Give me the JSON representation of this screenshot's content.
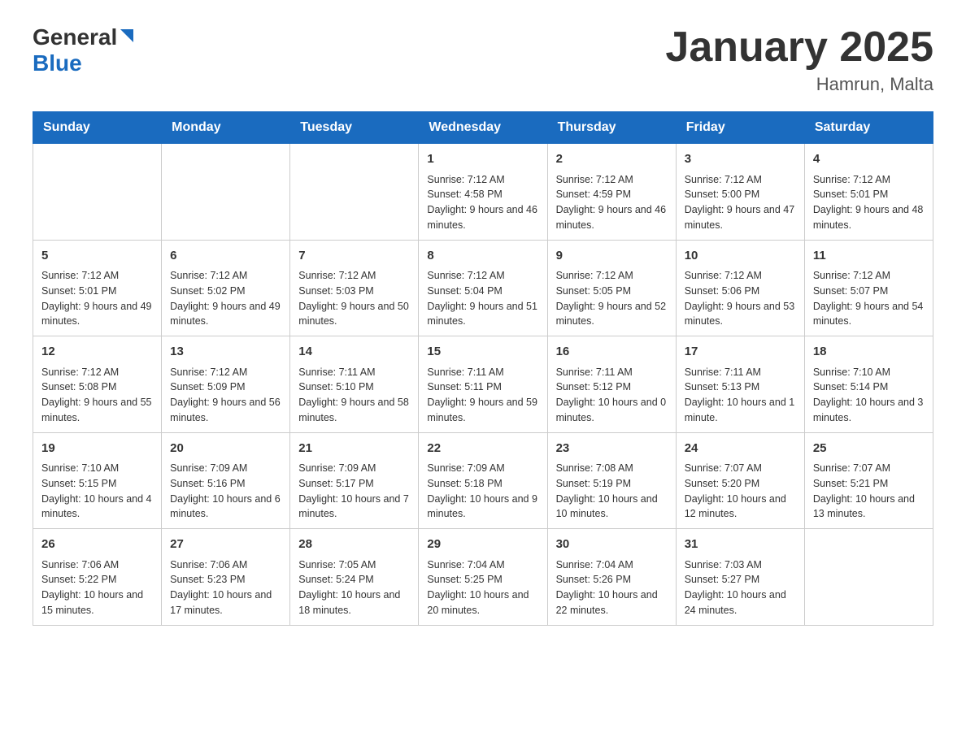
{
  "header": {
    "logo": {
      "general": "General",
      "blue": "Blue"
    },
    "title": "January 2025",
    "location": "Hamrun, Malta"
  },
  "weekdays": [
    "Sunday",
    "Monday",
    "Tuesday",
    "Wednesday",
    "Thursday",
    "Friday",
    "Saturday"
  ],
  "weeks": [
    [
      {
        "day": "",
        "info": ""
      },
      {
        "day": "",
        "info": ""
      },
      {
        "day": "",
        "info": ""
      },
      {
        "day": "1",
        "info": "Sunrise: 7:12 AM\nSunset: 4:58 PM\nDaylight: 9 hours\nand 46 minutes."
      },
      {
        "day": "2",
        "info": "Sunrise: 7:12 AM\nSunset: 4:59 PM\nDaylight: 9 hours\nand 46 minutes."
      },
      {
        "day": "3",
        "info": "Sunrise: 7:12 AM\nSunset: 5:00 PM\nDaylight: 9 hours\nand 47 minutes."
      },
      {
        "day": "4",
        "info": "Sunrise: 7:12 AM\nSunset: 5:01 PM\nDaylight: 9 hours\nand 48 minutes."
      }
    ],
    [
      {
        "day": "5",
        "info": "Sunrise: 7:12 AM\nSunset: 5:01 PM\nDaylight: 9 hours\nand 49 minutes."
      },
      {
        "day": "6",
        "info": "Sunrise: 7:12 AM\nSunset: 5:02 PM\nDaylight: 9 hours\nand 49 minutes."
      },
      {
        "day": "7",
        "info": "Sunrise: 7:12 AM\nSunset: 5:03 PM\nDaylight: 9 hours\nand 50 minutes."
      },
      {
        "day": "8",
        "info": "Sunrise: 7:12 AM\nSunset: 5:04 PM\nDaylight: 9 hours\nand 51 minutes."
      },
      {
        "day": "9",
        "info": "Sunrise: 7:12 AM\nSunset: 5:05 PM\nDaylight: 9 hours\nand 52 minutes."
      },
      {
        "day": "10",
        "info": "Sunrise: 7:12 AM\nSunset: 5:06 PM\nDaylight: 9 hours\nand 53 minutes."
      },
      {
        "day": "11",
        "info": "Sunrise: 7:12 AM\nSunset: 5:07 PM\nDaylight: 9 hours\nand 54 minutes."
      }
    ],
    [
      {
        "day": "12",
        "info": "Sunrise: 7:12 AM\nSunset: 5:08 PM\nDaylight: 9 hours\nand 55 minutes."
      },
      {
        "day": "13",
        "info": "Sunrise: 7:12 AM\nSunset: 5:09 PM\nDaylight: 9 hours\nand 56 minutes."
      },
      {
        "day": "14",
        "info": "Sunrise: 7:11 AM\nSunset: 5:10 PM\nDaylight: 9 hours\nand 58 minutes."
      },
      {
        "day": "15",
        "info": "Sunrise: 7:11 AM\nSunset: 5:11 PM\nDaylight: 9 hours\nand 59 minutes."
      },
      {
        "day": "16",
        "info": "Sunrise: 7:11 AM\nSunset: 5:12 PM\nDaylight: 10 hours\nand 0 minutes."
      },
      {
        "day": "17",
        "info": "Sunrise: 7:11 AM\nSunset: 5:13 PM\nDaylight: 10 hours\nand 1 minute."
      },
      {
        "day": "18",
        "info": "Sunrise: 7:10 AM\nSunset: 5:14 PM\nDaylight: 10 hours\nand 3 minutes."
      }
    ],
    [
      {
        "day": "19",
        "info": "Sunrise: 7:10 AM\nSunset: 5:15 PM\nDaylight: 10 hours\nand 4 minutes."
      },
      {
        "day": "20",
        "info": "Sunrise: 7:09 AM\nSunset: 5:16 PM\nDaylight: 10 hours\nand 6 minutes."
      },
      {
        "day": "21",
        "info": "Sunrise: 7:09 AM\nSunset: 5:17 PM\nDaylight: 10 hours\nand 7 minutes."
      },
      {
        "day": "22",
        "info": "Sunrise: 7:09 AM\nSunset: 5:18 PM\nDaylight: 10 hours\nand 9 minutes."
      },
      {
        "day": "23",
        "info": "Sunrise: 7:08 AM\nSunset: 5:19 PM\nDaylight: 10 hours\nand 10 minutes."
      },
      {
        "day": "24",
        "info": "Sunrise: 7:07 AM\nSunset: 5:20 PM\nDaylight: 10 hours\nand 12 minutes."
      },
      {
        "day": "25",
        "info": "Sunrise: 7:07 AM\nSunset: 5:21 PM\nDaylight: 10 hours\nand 13 minutes."
      }
    ],
    [
      {
        "day": "26",
        "info": "Sunrise: 7:06 AM\nSunset: 5:22 PM\nDaylight: 10 hours\nand 15 minutes."
      },
      {
        "day": "27",
        "info": "Sunrise: 7:06 AM\nSunset: 5:23 PM\nDaylight: 10 hours\nand 17 minutes."
      },
      {
        "day": "28",
        "info": "Sunrise: 7:05 AM\nSunset: 5:24 PM\nDaylight: 10 hours\nand 18 minutes."
      },
      {
        "day": "29",
        "info": "Sunrise: 7:04 AM\nSunset: 5:25 PM\nDaylight: 10 hours\nand 20 minutes."
      },
      {
        "day": "30",
        "info": "Sunrise: 7:04 AM\nSunset: 5:26 PM\nDaylight: 10 hours\nand 22 minutes."
      },
      {
        "day": "31",
        "info": "Sunrise: 7:03 AM\nSunset: 5:27 PM\nDaylight: 10 hours\nand 24 minutes."
      },
      {
        "day": "",
        "info": ""
      }
    ]
  ]
}
